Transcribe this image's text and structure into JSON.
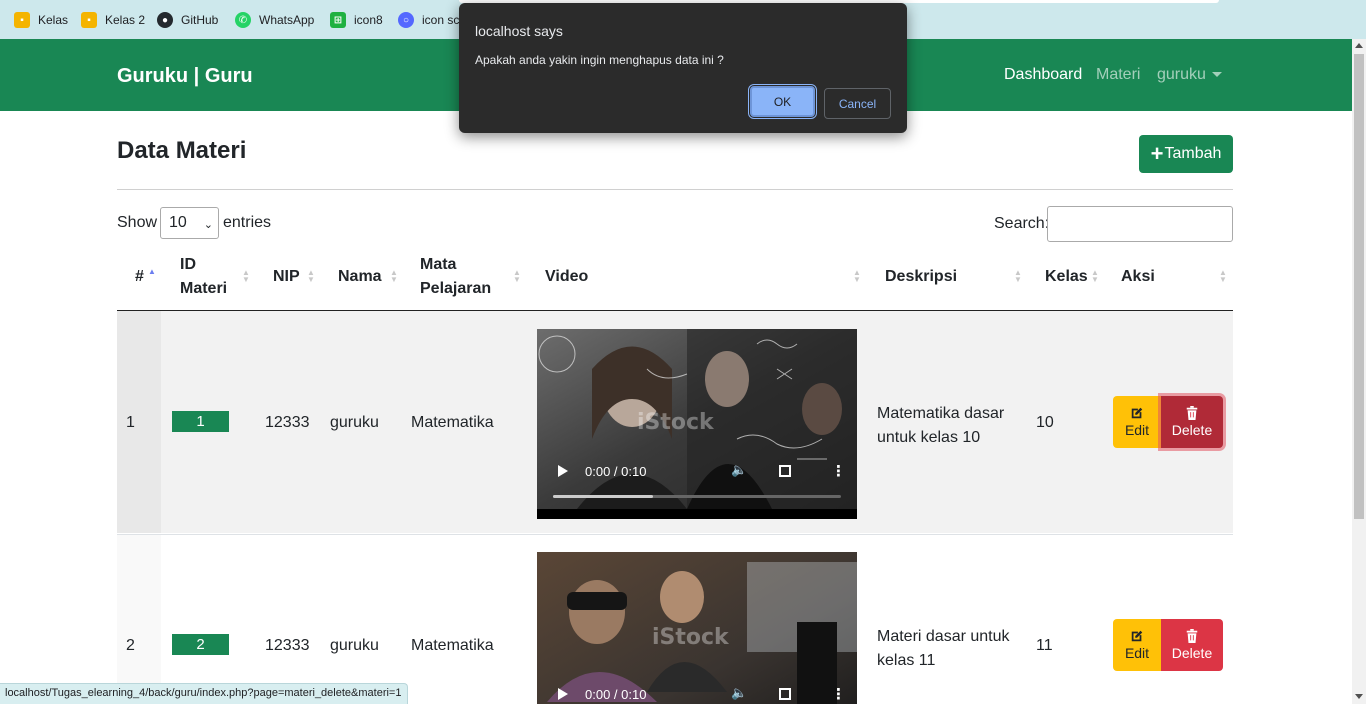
{
  "bookmarks": [
    {
      "label": "Kelas",
      "icon": "google-classroom-icon",
      "color": "#f4b400"
    },
    {
      "label": "Kelas 2",
      "icon": "google-classroom-icon",
      "color": "#f4b400"
    },
    {
      "label": "GitHub",
      "icon": "github-icon",
      "color": "#24292e"
    },
    {
      "label": "WhatsApp",
      "icon": "whatsapp-icon",
      "color": "#25d366"
    },
    {
      "label": "icon8",
      "icon": "icons8-icon",
      "color": "#1fb141"
    },
    {
      "label": "icon sc",
      "icon": "iconscout-icon",
      "color": "#5468ff"
    }
  ],
  "navbar": {
    "brand": "Guruku | Guru",
    "links": [
      "Dashboard",
      "Materi"
    ],
    "user": "guruku",
    "color": "#198754"
  },
  "page": {
    "title": "Data Materi",
    "add_button": "Tambah",
    "show_label": "Show",
    "entries_value": "10",
    "entries_label": "entries",
    "search_label": "Search:",
    "search_value": ""
  },
  "table": {
    "headers": {
      "no": "#",
      "id_line1": "ID",
      "id_line2": "Materi",
      "nip": "NIP",
      "nama": "Nama",
      "mapel_line1": "Mata",
      "mapel_line2": "Pelajaran",
      "video": "Video",
      "deskripsi": "Deskripsi",
      "kelas": "Kelas",
      "aksi": "Aksi"
    },
    "rows": [
      {
        "no": "1",
        "id": "1",
        "nip": "12333",
        "nama": "guruku",
        "mapel": "Matematika",
        "video_time": "0:00 / 0:10",
        "deskripsi_line1": "Matematika dasar",
        "deskripsi_line2": "untuk kelas 10",
        "kelas": "10",
        "edit_label": "Edit",
        "delete_label": "Delete"
      },
      {
        "no": "2",
        "id": "2",
        "nip": "12333",
        "nama": "guruku",
        "mapel": "Matematika",
        "video_time": "0:00 / 0:10",
        "deskripsi_line1": "Materi dasar untuk",
        "deskripsi_line2": "kelas 11",
        "kelas": "11",
        "edit_label": "Edit",
        "delete_label": "Delete"
      }
    ]
  },
  "statusbar": {
    "url": "localhost/Tugas_elearning_4/back/guru/index.php?page=materi_delete&materi=1"
  },
  "dialog": {
    "title": "localhost says",
    "message": "Apakah anda yakin ingin menghapus data ini ?",
    "ok_label": "OK",
    "cancel_label": "Cancel"
  }
}
